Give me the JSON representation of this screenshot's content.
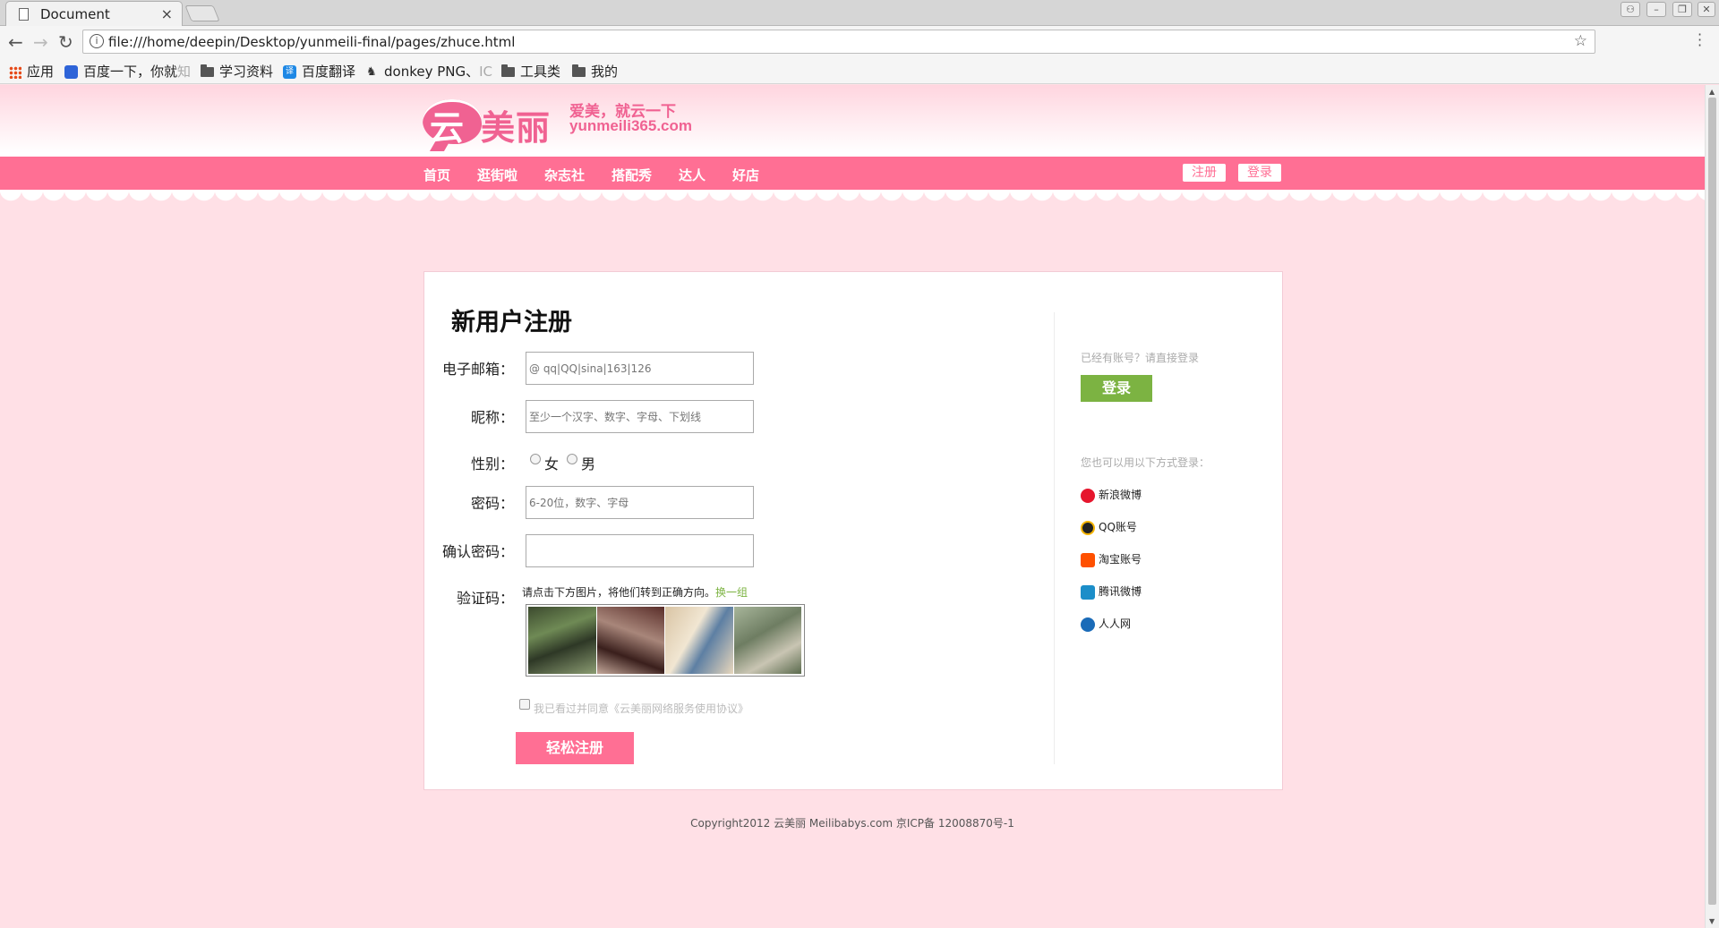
{
  "browser": {
    "tab_title": "Document",
    "tab_close": "×",
    "url": "file:///home/deepin/Desktop/yunmeili-final/pages/zhuce.html",
    "back": "←",
    "forward": "→",
    "reload": "↻",
    "star": "☆",
    "bookmarks": [
      {
        "label": "应用",
        "icon": "apps-icon"
      },
      {
        "label": "百度一下，你就",
        "fade": "知",
        "icon": "baidu-icon"
      },
      {
        "label": "学习资料",
        "icon": "folder-icon"
      },
      {
        "label": "百度翻译",
        "icon": "translate-icon"
      },
      {
        "label": "donkey PNG、",
        "fade": "IC",
        "icon": "donkey-icon"
      },
      {
        "label": "工具类",
        "icon": "folder-icon"
      },
      {
        "label": "我的",
        "icon": "folder-icon"
      }
    ]
  },
  "site": {
    "logo_first": "云",
    "logo_rest": "美丽",
    "slogan": "爱美，就云一下",
    "domain": "yunmeili365.com",
    "nav": [
      "首页",
      "逛街啦",
      "杂志社",
      "搭配秀",
      "达人",
      "好店"
    ],
    "register_btn": "注册",
    "login_btn": "登录"
  },
  "form": {
    "title": "新用户注册",
    "email_label": "电子邮箱：",
    "email_placeholder": "@ qq|QQ|sina|163|126",
    "nickname_label": "昵称：",
    "nickname_placeholder": "至少一个汉字、数字、字母、下划线",
    "gender_label": "性别：",
    "gender_female": "女",
    "gender_male": "男",
    "password_label": "密码：",
    "password_placeholder": "6-20位，数字、字母",
    "confirm_label": "确认密码：",
    "captcha_label": "验证码：",
    "captcha_hint": "请点击下方图片，将他们转到正确方向。",
    "captcha_change": "换一组",
    "agreement": "我已看过并同意《云美丽网络服务使用协议》",
    "submit": "轻松注册"
  },
  "side": {
    "have_account": "已经有账号？请直接登录",
    "login": "登录",
    "alt_login": "您也可以用以下方式登录：",
    "providers": [
      "新浪微博",
      "QQ账号",
      "淘宝账号",
      "腾讯微博",
      "人人网"
    ]
  },
  "footer": "Copyright2012 云美丽 Meilibabys.com 京ICP备 12008870号-1"
}
